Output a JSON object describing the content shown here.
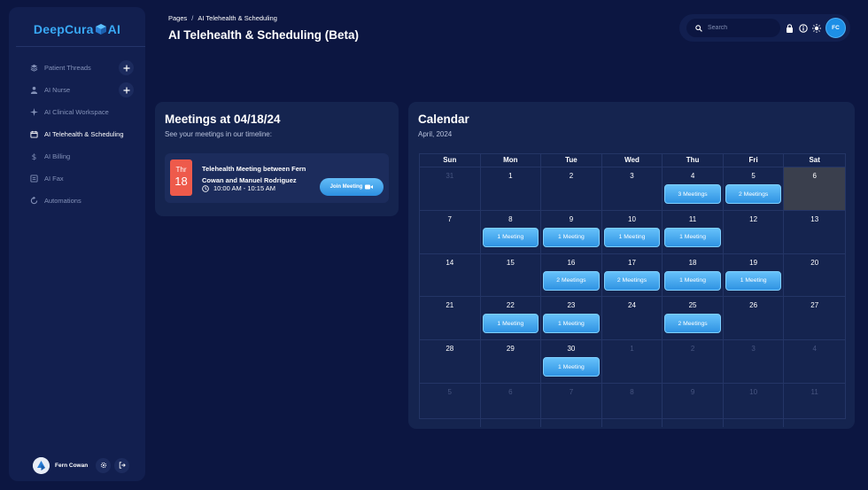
{
  "logo": {
    "left": "DeepCura",
    "right": "AI"
  },
  "sidebar": {
    "items": [
      {
        "label": "Patient Threads",
        "icon": "layers-icon",
        "has_add": true,
        "active": false
      },
      {
        "label": "AI Nurse",
        "icon": "nurse-icon",
        "has_add": true,
        "active": false
      },
      {
        "label": "AI Clinical Workspace",
        "icon": "sparkle-icon",
        "has_add": false,
        "active": false
      },
      {
        "label": "AI Telehealth & Scheduling",
        "icon": "calendar-icon",
        "has_add": false,
        "active": true
      },
      {
        "label": "AI Billing",
        "icon": "dollar-icon",
        "has_add": false,
        "active": false
      },
      {
        "label": "AI Fax",
        "icon": "fax-icon",
        "has_add": false,
        "active": false
      },
      {
        "label": "Automations",
        "icon": "automation-icon",
        "has_add": false,
        "active": false
      }
    ],
    "user": {
      "name": "Fern Cowan"
    }
  },
  "header": {
    "breadcrumb_root": "Pages",
    "breadcrumb_sep": "/",
    "breadcrumb_current": "AI Telehealth & Scheduling",
    "title": "AI Telehealth & Scheduling (Beta)"
  },
  "topbar": {
    "search_placeholder": "Search",
    "avatar_initials": "FC"
  },
  "meetings": {
    "title": "Meetings at 04/18/24",
    "subtitle": "See your meetings in our timeline:",
    "items": [
      {
        "dow": "Thr",
        "dom": "18",
        "name": "Telehealth Meeting between Fern Cowan and Manuel Rodriguez",
        "time": "10:00 AM - 10:15 AM",
        "join_label": "Join Meeting"
      }
    ]
  },
  "calendar": {
    "title": "Calendar",
    "subtitle": "April, 2024",
    "weekdays": [
      "Sun",
      "Mon",
      "Tue",
      "Wed",
      "Thu",
      "Fri",
      "Sat"
    ],
    "today": "6",
    "cells": [
      {
        "day": "31",
        "other": true,
        "meetings": ""
      },
      {
        "day": "1",
        "other": false,
        "meetings": ""
      },
      {
        "day": "2",
        "other": false,
        "meetings": ""
      },
      {
        "day": "3",
        "other": false,
        "meetings": ""
      },
      {
        "day": "4",
        "other": false,
        "meetings": "3 Meetings"
      },
      {
        "day": "5",
        "other": false,
        "meetings": "2 Meetings"
      },
      {
        "day": "6",
        "other": false,
        "meetings": "",
        "today": true
      },
      {
        "day": "7",
        "other": false,
        "meetings": ""
      },
      {
        "day": "8",
        "other": false,
        "meetings": "1 Meeting"
      },
      {
        "day": "9",
        "other": false,
        "meetings": "1 Meeting"
      },
      {
        "day": "10",
        "other": false,
        "meetings": "1 Meeting"
      },
      {
        "day": "11",
        "other": false,
        "meetings": "1 Meeting"
      },
      {
        "day": "12",
        "other": false,
        "meetings": ""
      },
      {
        "day": "13",
        "other": false,
        "meetings": ""
      },
      {
        "day": "14",
        "other": false,
        "meetings": ""
      },
      {
        "day": "15",
        "other": false,
        "meetings": ""
      },
      {
        "day": "16",
        "other": false,
        "meetings": "2 Meetings"
      },
      {
        "day": "17",
        "other": false,
        "meetings": "2 Meetings"
      },
      {
        "day": "18",
        "other": false,
        "meetings": "1 Meeting"
      },
      {
        "day": "19",
        "other": false,
        "meetings": "1 Meeting"
      },
      {
        "day": "20",
        "other": false,
        "meetings": ""
      },
      {
        "day": "21",
        "other": false,
        "meetings": ""
      },
      {
        "day": "22",
        "other": false,
        "meetings": "1 Meeting"
      },
      {
        "day": "23",
        "other": false,
        "meetings": "1 Meeting"
      },
      {
        "day": "24",
        "other": false,
        "meetings": ""
      },
      {
        "day": "25",
        "other": false,
        "meetings": "2 Meetings"
      },
      {
        "day": "26",
        "other": false,
        "meetings": ""
      },
      {
        "day": "27",
        "other": false,
        "meetings": ""
      },
      {
        "day": "28",
        "other": false,
        "meetings": ""
      },
      {
        "day": "29",
        "other": false,
        "meetings": ""
      },
      {
        "day": "30",
        "other": false,
        "meetings": "1 Meeting"
      },
      {
        "day": "1",
        "other": true,
        "meetings": ""
      },
      {
        "day": "2",
        "other": true,
        "meetings": ""
      },
      {
        "day": "3",
        "other": true,
        "meetings": ""
      },
      {
        "day": "4",
        "other": true,
        "meetings": ""
      },
      {
        "day": "5",
        "other": true,
        "meetings": ""
      },
      {
        "day": "6",
        "other": true,
        "meetings": ""
      },
      {
        "day": "7",
        "other": true,
        "meetings": ""
      },
      {
        "day": "8",
        "other": true,
        "meetings": ""
      },
      {
        "day": "9",
        "other": true,
        "meetings": ""
      },
      {
        "day": "10",
        "other": true,
        "meetings": ""
      },
      {
        "day": "11",
        "other": true,
        "meetings": ""
      }
    ]
  },
  "colors": {
    "background": "#0c1641",
    "panel": "#15244f",
    "accent": "#39a8f5",
    "date_badge": "#ee5a4b"
  }
}
